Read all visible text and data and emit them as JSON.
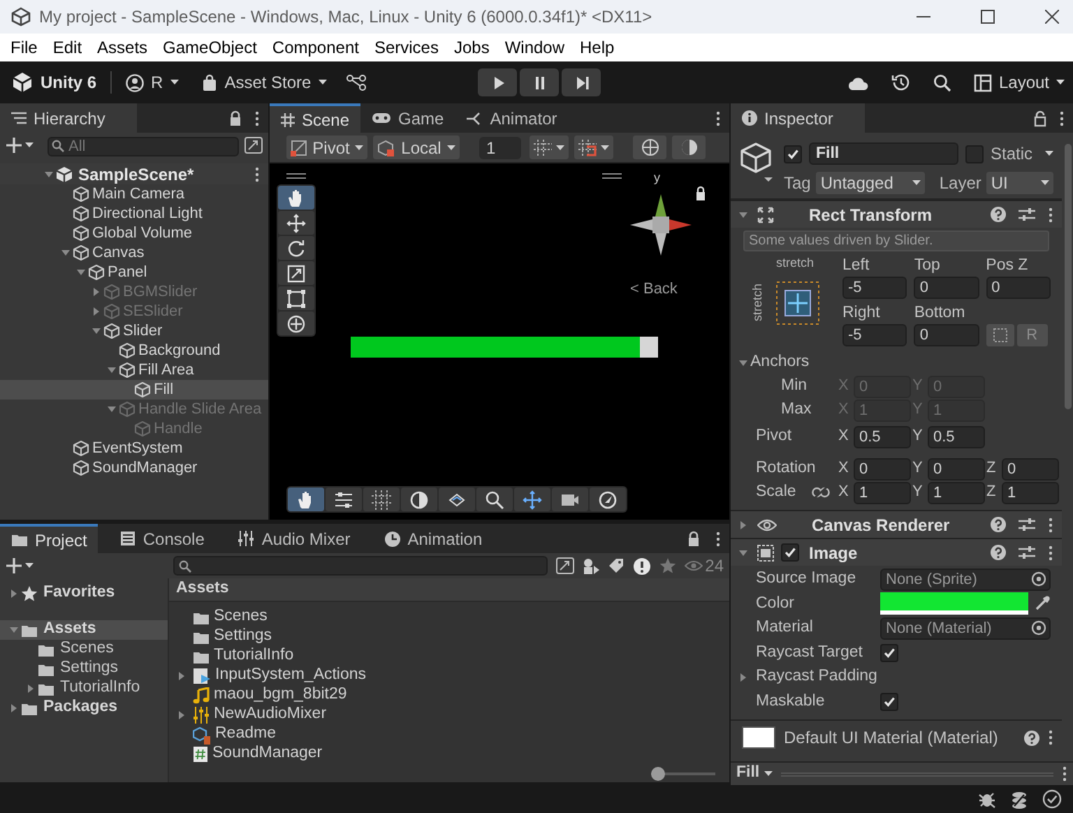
{
  "window": {
    "title": "My project - SampleScene - Windows, Mac, Linux - Unity 6 (6000.0.34f1)* <DX11>"
  },
  "menu": [
    "File",
    "Edit",
    "Assets",
    "GameObject",
    "Component",
    "Services",
    "Jobs",
    "Window",
    "Help"
  ],
  "toolbar": {
    "product": "Unity 6",
    "account": "R",
    "asset_store": "Asset Store",
    "layout": "Layout"
  },
  "hierarchy": {
    "tab": "Hierarchy",
    "search_placeholder": "All",
    "scene": {
      "label": "SampleScene*",
      "expanded": true
    },
    "items": [
      {
        "label": "Main Camera",
        "disabled": false,
        "selected": false
      },
      {
        "label": "Directional Light",
        "disabled": false,
        "selected": false
      },
      {
        "label": "Global Volume",
        "disabled": false,
        "selected": false
      },
      {
        "label": "Canvas",
        "expanded": true,
        "disabled": false,
        "selected": false,
        "children": [
          {
            "label": "Panel",
            "expanded": true,
            "disabled": false,
            "selected": false,
            "children": [
              {
                "label": "BGMSlider",
                "expanded": false,
                "disabled": true,
                "selected": false
              },
              {
                "label": "SESlider",
                "expanded": false,
                "disabled": true,
                "selected": false
              },
              {
                "label": "Slider",
                "expanded": true,
                "disabled": false,
                "selected": false,
                "children": [
                  {
                    "label": "Background",
                    "disabled": false,
                    "selected": false
                  },
                  {
                    "label": "Fill Area",
                    "expanded": true,
                    "disabled": false,
                    "selected": false,
                    "children": [
                      {
                        "label": "Fill",
                        "disabled": false,
                        "selected": true
                      }
                    ]
                  },
                  {
                    "label": "Handle Slide Area",
                    "expanded": true,
                    "disabled": true,
                    "selected": false,
                    "children": [
                      {
                        "label": "Handle",
                        "disabled": true,
                        "selected": false
                      }
                    ]
                  }
                ]
              }
            ]
          }
        ]
      },
      {
        "label": "EventSystem",
        "disabled": false,
        "selected": false
      },
      {
        "label": "SoundManager",
        "disabled": false,
        "selected": false
      }
    ]
  },
  "scene": {
    "tabs": [
      {
        "label": "Scene",
        "selected": true
      },
      {
        "label": "Game",
        "selected": false
      },
      {
        "label": "Animator",
        "selected": false
      }
    ],
    "pivot": "Pivot",
    "space": "Local",
    "grid_size": "1",
    "tools": [
      {
        "selected": true
      },
      {
        "selected": false
      },
      {
        "selected": false
      },
      {
        "selected": false
      },
      {
        "selected": false
      },
      {
        "selected": false
      }
    ],
    "overlay_tools": [
      {
        "selected": true
      },
      {
        "selected": false
      },
      {
        "selected": false
      },
      {
        "selected": false
      },
      {
        "selected": false
      },
      {
        "selected": false
      },
      {
        "selected": false
      },
      {
        "selected": false
      },
      {
        "selected": false
      }
    ],
    "gizmo_axis": "y",
    "back": "< Back",
    "slider": {
      "level": 0.94
    }
  },
  "project": {
    "tabs": [
      {
        "label": "Project",
        "selected": true
      },
      {
        "label": "Console",
        "selected": false
      },
      {
        "label": "Audio Mixer",
        "selected": false
      },
      {
        "label": "Animation",
        "selected": false
      }
    ],
    "count": "24",
    "tree": [
      {
        "kind": "favorites",
        "label": "Favorites",
        "expanded": false,
        "selected": false
      },
      {
        "kind": "folder",
        "label": "Assets",
        "expanded": true,
        "selected": true,
        "children": [
          {
            "kind": "folder",
            "label": "Scenes",
            "selected": false
          },
          {
            "kind": "folder",
            "label": "Settings",
            "selected": false
          },
          {
            "kind": "folder",
            "label": "TutorialInfo",
            "expanded": false,
            "selected": false
          }
        ]
      },
      {
        "kind": "folder",
        "label": "Packages",
        "expanded": false,
        "selected": false
      }
    ],
    "path": "Assets",
    "files": [
      {
        "kind": "folder",
        "label": "Scenes"
      },
      {
        "kind": "folder",
        "label": "Settings"
      },
      {
        "kind": "folder",
        "label": "TutorialInfo"
      },
      {
        "kind": "input",
        "label": "InputSystem_Actions",
        "expanded": false
      },
      {
        "kind": "audio",
        "label": "maou_bgm_8bit29"
      },
      {
        "kind": "mixer",
        "label": "NewAudioMixer",
        "expanded": false
      },
      {
        "kind": "readme",
        "label": "Readme"
      },
      {
        "kind": "script",
        "label": "SoundManager"
      }
    ],
    "zoom": {
      "level": 0
    }
  },
  "inspector": {
    "tab": "Inspector",
    "object": {
      "name": "Fill",
      "active": true,
      "static_label": "Static",
      "static": false,
      "tag_label": "Tag",
      "tag": "Untagged",
      "layer_label": "Layer",
      "layer": "UI"
    },
    "rect_transform": {
      "title": "Rect Transform",
      "expanded": true,
      "note": "Some values driven by Slider.",
      "anchor_h": "stretch",
      "anchor_v": "stretch",
      "fields": [
        {
          "label": "Left",
          "value": "-5"
        },
        {
          "label": "Top",
          "value": "0"
        },
        {
          "label": "Pos Z",
          "value": "0"
        },
        {
          "label": "Right",
          "value": "-5"
        },
        {
          "label": "Bottom",
          "value": "0"
        }
      ],
      "raw_button": "R",
      "anchors": {
        "label": "Anchors",
        "expanded": true,
        "rows": [
          {
            "label": "Min",
            "disabled": true,
            "axes": [
              {
                "axis": "X",
                "value": "0"
              },
              {
                "axis": "Y",
                "value": "0"
              }
            ]
          },
          {
            "label": "Max",
            "disabled": true,
            "axes": [
              {
                "axis": "X",
                "value": "1"
              },
              {
                "axis": "Y",
                "value": "1"
              }
            ]
          }
        ]
      },
      "vectors": [
        {
          "kind": "pivot",
          "label": "Pivot",
          "axes": [
            {
              "axis": "X",
              "value": "0.5"
            },
            {
              "axis": "Y",
              "value": "0.5"
            }
          ]
        },
        {
          "kind": "rotation",
          "label": "Rotation",
          "axes": [
            {
              "axis": "X",
              "value": "0"
            },
            {
              "axis": "Y",
              "value": "0"
            },
            {
              "axis": "Z",
              "value": "0"
            }
          ]
        },
        {
          "kind": "scale",
          "label": "Scale",
          "axes": [
            {
              "axis": "X",
              "value": "1"
            },
            {
              "axis": "Y",
              "value": "1"
            },
            {
              "axis": "Z",
              "value": "1"
            }
          ]
        }
      ]
    },
    "canvas_renderer": {
      "title": "Canvas Renderer",
      "expanded": false
    },
    "image": {
      "title": "Image",
      "expanded": true,
      "enabled": true,
      "props": [
        {
          "kind": "object",
          "label": "Source Image",
          "value": "None (Sprite)"
        },
        {
          "kind": "color",
          "label": "Color",
          "color": "#12e632"
        },
        {
          "kind": "object",
          "label": "Material",
          "value": "None (Material)"
        },
        {
          "kind": "toggle",
          "label": "Raycast Target",
          "checked": true
        },
        {
          "kind": "foldout",
          "label": "Raycast Padding",
          "expanded": false
        },
        {
          "kind": "toggle",
          "label": "Maskable",
          "checked": true
        }
      ]
    },
    "material": {
      "label": "Default UI Material (Material)"
    },
    "footer": {
      "label": "Fill"
    }
  }
}
